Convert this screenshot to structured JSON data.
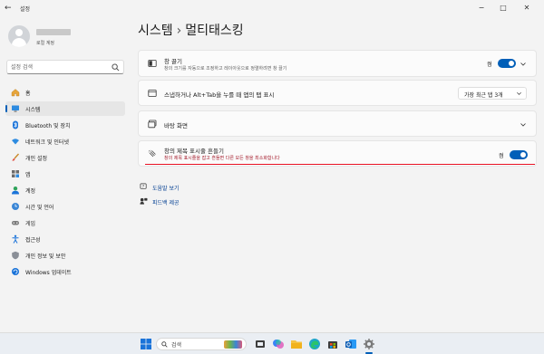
{
  "window": {
    "title": "설정",
    "controls": {
      "minimize": "−",
      "maximize": "□",
      "close": "✕"
    }
  },
  "user": {
    "account_type": "로컬 계정"
  },
  "search": {
    "placeholder": "설정 검색"
  },
  "sidebar": {
    "items": [
      {
        "label": "홈",
        "icon": "home-icon",
        "active": false
      },
      {
        "label": "시스템",
        "icon": "system-icon",
        "active": true
      },
      {
        "label": "Bluetooth 및 장치",
        "icon": "bluetooth-icon",
        "active": false
      },
      {
        "label": "네트워크 및 인터넷",
        "icon": "wifi-icon",
        "active": false
      },
      {
        "label": "개인 설정",
        "icon": "brush-icon",
        "active": false
      },
      {
        "label": "앱",
        "icon": "apps-icon",
        "active": false
      },
      {
        "label": "계정",
        "icon": "account-icon",
        "active": false
      },
      {
        "label": "시간 및 언어",
        "icon": "globe-clock-icon",
        "active": false
      },
      {
        "label": "게임",
        "icon": "gamepad-icon",
        "active": false
      },
      {
        "label": "접근성",
        "icon": "accessibility-icon",
        "active": false
      },
      {
        "label": "개인 정보 및 보안",
        "icon": "shield-icon",
        "active": false
      },
      {
        "label": "Windows 업데이트",
        "icon": "update-icon",
        "active": false
      }
    ]
  },
  "breadcrumb": {
    "parent": "시스템",
    "separator": "›",
    "current": "멀티태스킹"
  },
  "settings": {
    "snap": {
      "title": "창 끌기",
      "subtitle": "창의 크기를 자동으로 조정하고 레이아웃으로 정렬하려면 창 끌기",
      "state_label": "켬",
      "on": true
    },
    "alt_tab": {
      "title": "스냅하거나 Alt+Tab을 누를 때 앱의 탭 표시",
      "dropdown_value": "가장 최근 탭 3개"
    },
    "desktops": {
      "title": "바탕 화면"
    },
    "shake": {
      "title": "창의 제목 표시줄 흔들기",
      "subtitle": "창의 제목 표시줄을 잡고 흔들면 다른 모든 창을 최소화합니다",
      "state_label": "켬",
      "on": true
    }
  },
  "links": {
    "help": "도움말 보기",
    "feedback": "피드백 제공"
  },
  "taskbar": {
    "search_label": "검색"
  },
  "colors": {
    "accent": "#005fb8",
    "highlight_underline": "#e81123"
  }
}
